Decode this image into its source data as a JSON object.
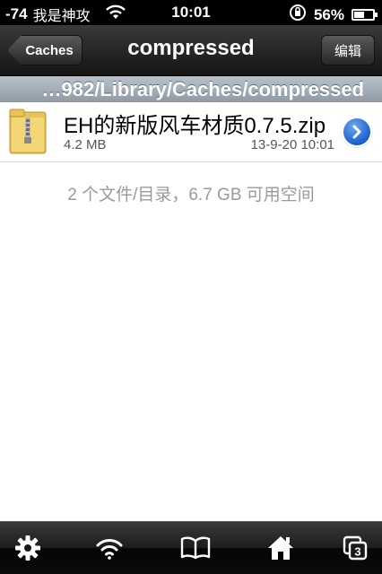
{
  "status_bar": {
    "signal": "-74",
    "carrier": "我是神攻",
    "time": "10:01",
    "battery_percent": "56%",
    "battery_level": 0.56
  },
  "nav_bar": {
    "back_label": "Caches",
    "title": "compressed",
    "edit_label": "编辑"
  },
  "path_bar": {
    "path": "…982/Library/Caches/compressed"
  },
  "files": [
    {
      "name": "EH的新版风车材质0.7.5.zip",
      "size": "4.2 MB",
      "date": "13-9-20 10:01",
      "icon": "zip-folder-icon"
    }
  ],
  "summary": "2 个文件/目录，6.7 GB 可用空间",
  "tab_bar": {
    "items": [
      {
        "icon": "gear-icon"
      },
      {
        "icon": "wifi-icon"
      },
      {
        "icon": "book-icon"
      },
      {
        "icon": "home-icon"
      },
      {
        "icon": "windows-icon",
        "badge": "3"
      }
    ]
  },
  "colors": {
    "path_bar": "#9aa5b0",
    "disclosure_blue": "#1a5fcf",
    "summary_text": "#9a9a9a"
  }
}
